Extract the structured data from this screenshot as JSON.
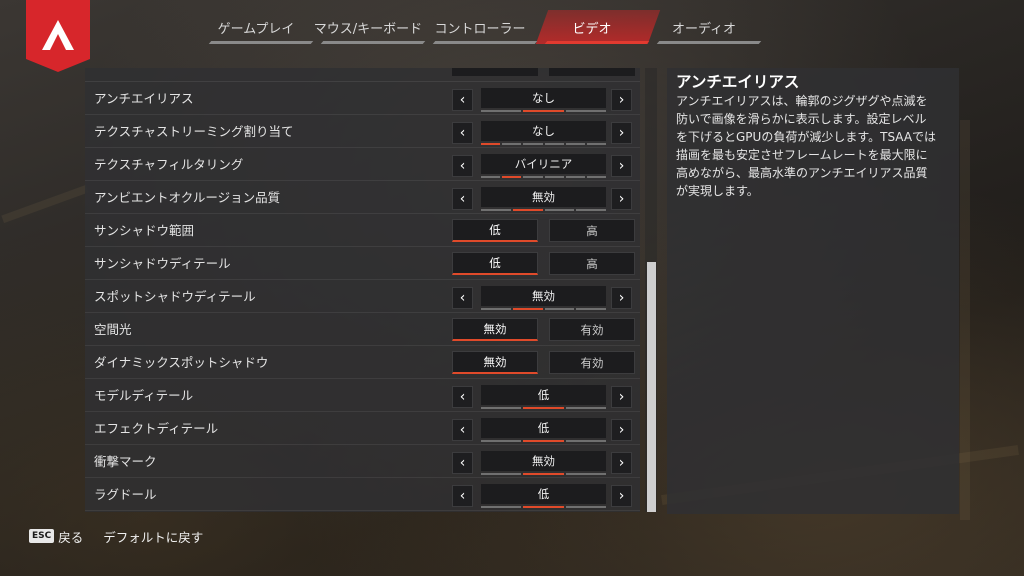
{
  "tabs": [
    {
      "label": "ゲームプレイ",
      "active": false
    },
    {
      "label": "マウス/キーボード",
      "active": false
    },
    {
      "label": "コントローラー",
      "active": false
    },
    {
      "label": "ビデオ",
      "active": true
    },
    {
      "label": "オーディオ",
      "active": false
    }
  ],
  "settings": [
    {
      "name": "アンチエイリアス",
      "type": "arrow",
      "value": "なし",
      "segments": 3,
      "active_segment": 1
    },
    {
      "name": "テクスチャストリーミング割り当て",
      "type": "arrow",
      "value": "なし",
      "segments": 6,
      "active_segment": 0
    },
    {
      "name": "テクスチャフィルタリング",
      "type": "arrow",
      "value": "バイリニア",
      "segments": 6,
      "active_segment": 1
    },
    {
      "name": "アンビエントオクルージョン品質",
      "type": "arrow",
      "value": "無効",
      "segments": 4,
      "active_segment": 1
    },
    {
      "name": "サンシャドウ範囲",
      "type": "toggle",
      "option_a": "低",
      "option_b": "高",
      "selected": "a"
    },
    {
      "name": "サンシャドウディテール",
      "type": "toggle",
      "option_a": "低",
      "option_b": "高",
      "selected": "a"
    },
    {
      "name": "スポットシャドウディテール",
      "type": "arrow",
      "value": "無効",
      "segments": 4,
      "active_segment": 1
    },
    {
      "name": "空間光",
      "type": "toggle",
      "option_a": "無効",
      "option_b": "有効",
      "selected": "a"
    },
    {
      "name": "ダイナミックスポットシャドウ",
      "type": "toggle",
      "option_a": "無効",
      "option_b": "有効",
      "selected": "a"
    },
    {
      "name": "モデルディテール",
      "type": "arrow",
      "value": "低",
      "segments": 3,
      "active_segment": 1
    },
    {
      "name": "エフェクトディテール",
      "type": "arrow",
      "value": "低",
      "segments": 3,
      "active_segment": 1
    },
    {
      "name": "衝撃マーク",
      "type": "arrow",
      "value": "無効",
      "segments": 3,
      "active_segment": 1
    },
    {
      "name": "ラグドール",
      "type": "arrow",
      "value": "低",
      "segments": 3,
      "active_segment": 1
    }
  ],
  "description": {
    "title": "アンチエイリアス",
    "lines": [
      "アンチエイリアスは、輪郭のジグザグや点滅を",
      "防いで画像を滑らかに表示します。設定レベル",
      "を下げるとGPUの負荷が減少します。TSAAでは",
      "描画を最も安定させフレームレートを最大限に",
      "高めながら、最高水準のアンチエイリアス品質",
      "が実現します。"
    ]
  },
  "footer": {
    "esc_key": "ESC",
    "back_label": "戻る",
    "reset_label": "デフォルトに戻す"
  },
  "colors": {
    "accent": "#e04a2a",
    "logo": "#d7262b",
    "panel": "#303032"
  },
  "icons": {
    "logo": "apex-logo-icon",
    "arrow_left": "chevron-left-icon",
    "arrow_right": "chevron-right-icon"
  }
}
